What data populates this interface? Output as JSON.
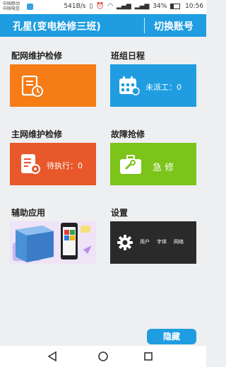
{
  "status_bar": {
    "carrier1": "中国移动",
    "carrier2": "中国电信",
    "speed": "541B/s",
    "battery": "34%",
    "time": "10:56"
  },
  "header": {
    "title": "孔星(变电检修三班)",
    "switch_account": "切换账号"
  },
  "modules": [
    {
      "label": "配网维护检修",
      "color": "#f57c16"
    },
    {
      "label": "班组日程",
      "color": "#1f9de0",
      "tile_text": "未派工：0"
    },
    {
      "label": "主网维护检修",
      "color": "#e8582a",
      "tile_text": "待执行：0"
    },
    {
      "label": "故障抢修",
      "color": "#7cc31a",
      "tile_text": "急 修"
    },
    {
      "label": "辅助应用"
    },
    {
      "label": "设置",
      "color": "#2a2a2a",
      "tile_items": [
        "用户",
        "字体",
        "网络"
      ]
    }
  ],
  "hide_button": "隐藏",
  "colors": {
    "accent": "#1f9de0",
    "background": "#eeeff1"
  }
}
